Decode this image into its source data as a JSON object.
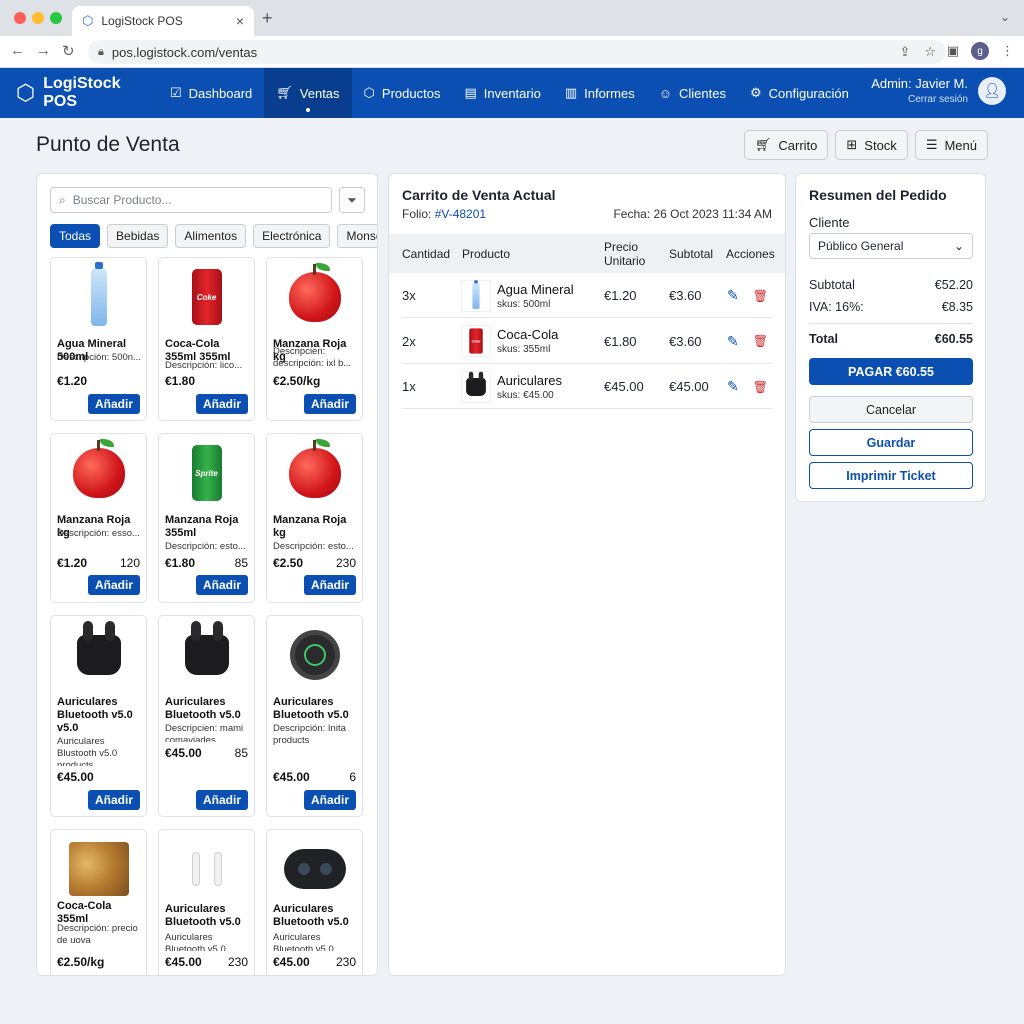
{
  "browser": {
    "tab_title": "LogiStock POS",
    "url": "pos.logistock.com/ventas",
    "profile_initial": "g"
  },
  "nav": {
    "brand": "LogiStock POS",
    "items": [
      {
        "label": "Dashboard",
        "icon": "chart-square-icon"
      },
      {
        "label": "Ventas",
        "icon": "cart-icon",
        "active": true
      },
      {
        "label": "Productos",
        "icon": "box-icon"
      },
      {
        "label": "Inventario",
        "icon": "archive-icon"
      },
      {
        "label": "Informes",
        "icon": "bar-chart-icon"
      },
      {
        "label": "Clientes",
        "icon": "users-icon"
      },
      {
        "label": "Configuración",
        "icon": "gear-icon"
      }
    ],
    "user_name": "Admin: Javier M.",
    "logout": "Cerrar sesión"
  },
  "page": {
    "title": "Punto de Venta",
    "buttons": [
      "Carrito",
      "Stock",
      "Menú"
    ]
  },
  "products": {
    "search_placeholder": "Buscar Producto...",
    "chips": [
      "Todas",
      "Bebidas",
      "Alimentos",
      "Electrónica",
      "Monserario"
    ],
    "add_label": "Añadir",
    "items": [
      {
        "name": "Agua Mineral 500ml",
        "desc": "Descripción: 500n...",
        "price": "€1.20",
        "stock": "",
        "img": "bottle"
      },
      {
        "name": "Coca-Cola 355ml 355ml",
        "desc": "Descripción: lico...",
        "price": "€1.80",
        "stock": "",
        "img": "can-red"
      },
      {
        "name": "Manzana Roja kg",
        "desc": "Descripcien: descripción: ixl b...",
        "price": "€2.50/kg",
        "stock": "",
        "img": "apple"
      },
      {
        "name": "Manzana Roja kg",
        "desc": "Descripción: esso...",
        "price": "€1.20",
        "stock": "120",
        "img": "apple"
      },
      {
        "name": "Manzana Roja 355ml",
        "desc": "Descripción: esto...",
        "price": "€1.80",
        "stock": "85",
        "img": "can-green"
      },
      {
        "name": "Manzana Roja kg",
        "desc": "Descripción: esto...",
        "price": "€2.50",
        "stock": "230",
        "img": "apple"
      },
      {
        "name": "Auriculares Bluetooth v5.0 v5.0",
        "desc": "Auriculares Blustooth v5.0 products",
        "price": "€45.00",
        "stock": "",
        "img": "earbuds"
      },
      {
        "name": "Auriculares Bluetooth v5.0",
        "desc": "Descripcien: mami comaviades",
        "price": "€45.00",
        "stock": "85",
        "img": "earbuds"
      },
      {
        "name": "Auriculares Bluetooth v5.0",
        "desc": "Descripción: Inita products",
        "price": "€45.00",
        "stock": "6",
        "img": "watch"
      },
      {
        "name": "Coca-Cola 355ml",
        "desc": "Descripción: precio de uova",
        "price": "€2.50/kg",
        "stock": "",
        "img": "chips"
      },
      {
        "name": "Auriculares Bluetooth v5.0",
        "desc": "Auriculares Bluetooth v5.0",
        "price": "€45.00",
        "stock": "230",
        "img": "whitebuds"
      },
      {
        "name": "Auriculares Bluetooth v5.0",
        "desc": "Auriculares Bluetooth v5.0",
        "price": "€45.00",
        "stock": "230",
        "img": "darkcase"
      }
    ]
  },
  "cart": {
    "title": "Carrito de Venta Actual",
    "folio_label": "Folio:",
    "folio": "#V-48201",
    "fecha": "Fecha: 26 Oct 2023 11:34 AM",
    "headers": [
      "Cantidad",
      "Producto",
      "Precio Unitario",
      "Subtotal",
      "Acciones"
    ],
    "rows": [
      {
        "qty": "3x",
        "name": "Agua Mineral",
        "sku": "skus: 500ml",
        "unit": "€1.20",
        "subtotal": "€3.60",
        "img": "bottle"
      },
      {
        "qty": "2x",
        "name": "Coca-Cola",
        "sku": "skus: 355ml",
        "unit": "€1.80",
        "subtotal": "€3.60",
        "img": "can-red"
      },
      {
        "qty": "1x",
        "name": "Auriculares",
        "sku": "skus: €45.00",
        "unit": "€45.00",
        "subtotal": "€45.00",
        "img": "earbuds"
      }
    ]
  },
  "summary": {
    "title": "Resumen del Pedido",
    "client_label": "Cliente",
    "client_value": "Público General",
    "subtotal_label": "Subtotal",
    "subtotal": "€52.20",
    "iva_label": "IVA: 16%:",
    "iva": "€8.35",
    "total_label": "Total",
    "total": "€60.55",
    "pay": "PAGAR €60.55",
    "cancel": "Cancelar",
    "save": "Guardar",
    "print": "Imprimir Ticket"
  }
}
